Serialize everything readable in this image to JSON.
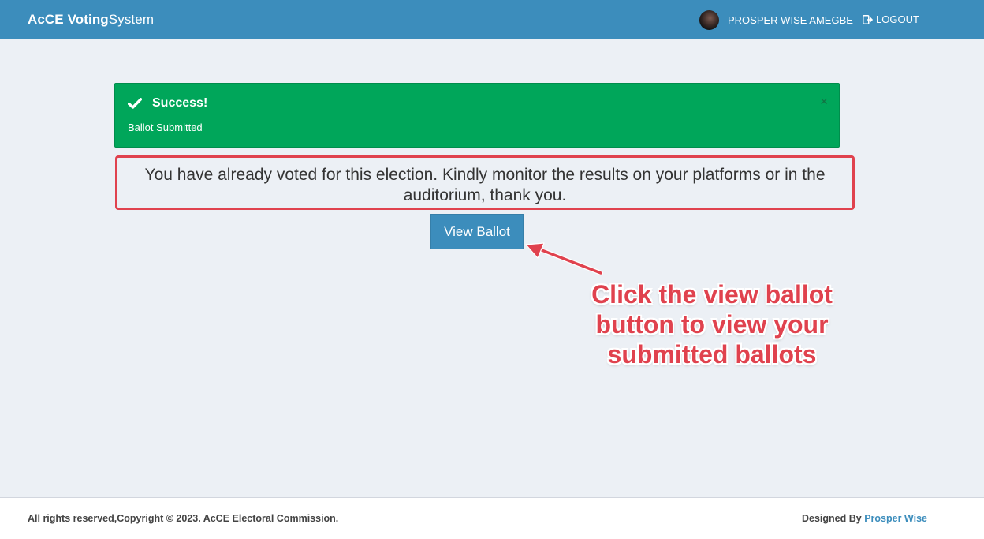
{
  "header": {
    "brand_bold": "AcCE Voting",
    "brand_rest": "System",
    "user_name": "PROSPER WISE AMEGBE",
    "logout_label": "LOGOUT"
  },
  "alert": {
    "title": "Success!",
    "message": "Ballot Submitted",
    "close_glyph": "×",
    "icon": "check-icon",
    "color": "#00a65a"
  },
  "notice": {
    "text": "You have already voted for this election. Kindly monitor the results on your platforms or in the auditorium, thank you."
  },
  "view_ballot_label": "View Ballot",
  "annotation": {
    "text": "Click the view ballot button to view your submitted ballots",
    "color": "#e0424e"
  },
  "footer": {
    "copyright": "All rights reserved,Copyright © 2023. AcCE Electoral Commission.",
    "designed_by_prefix": "Designed By",
    "designer": "Prosper Wise"
  },
  "colors": {
    "primary": "#3c8dbc",
    "background": "#ecf0f5"
  }
}
